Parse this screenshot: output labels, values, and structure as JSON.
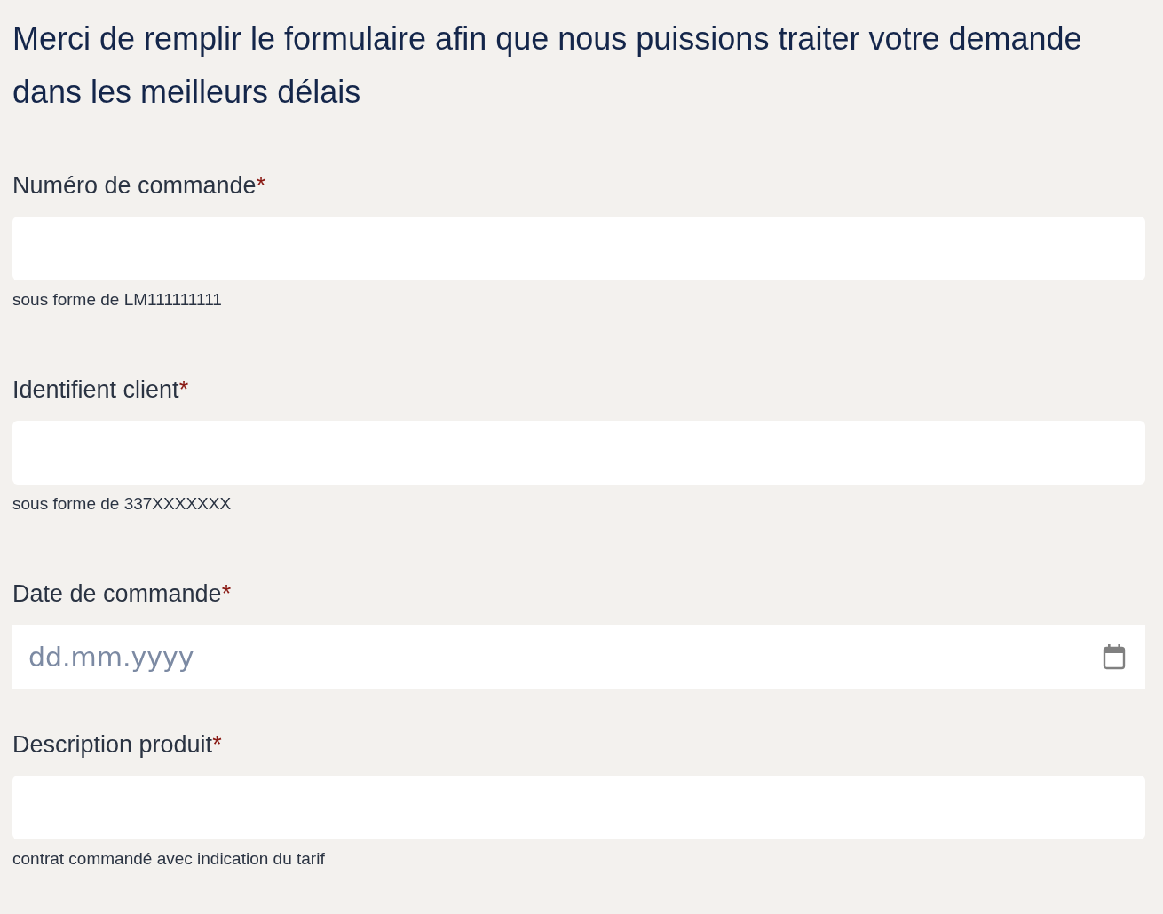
{
  "heading": "Merci de remplir le formulaire afin que nous puissions traiter votre demande dans les meilleurs délais",
  "fields": [
    {
      "kind": "text",
      "label": "Numéro de commande",
      "required_mark": "*",
      "hint": "sous forme de LM111111111"
    },
    {
      "kind": "text",
      "label": "Identifient client",
      "required_mark": "*",
      "hint": "sous forme de 337XXXXXXX"
    },
    {
      "kind": "date",
      "label": "Date de commande",
      "required_mark": "*",
      "placeholder": "dd.mm.yyyy"
    },
    {
      "kind": "text",
      "label": "Description produit",
      "required_mark": "*",
      "hint": "contrat commandé avec indication du tarif"
    }
  ]
}
